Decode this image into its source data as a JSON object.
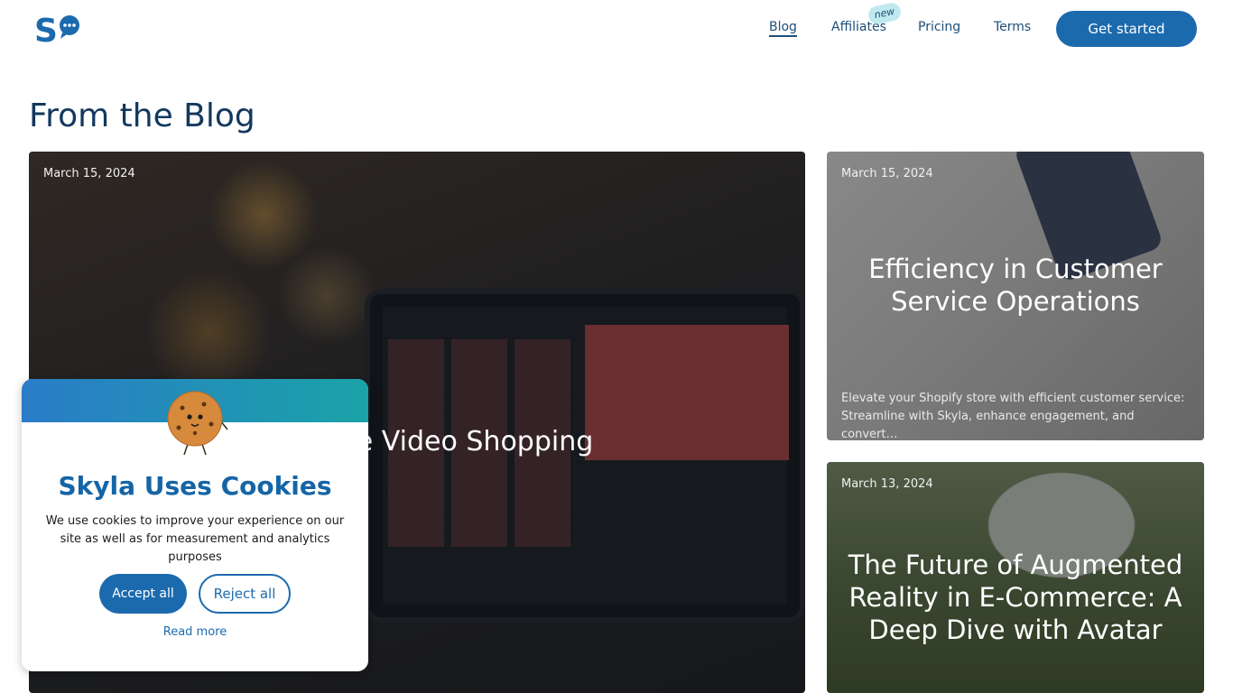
{
  "header": {
    "logo_text": "S",
    "nav": [
      {
        "label": "Blog",
        "active": true
      },
      {
        "label": "Affiliates",
        "active": false
      },
      {
        "label": "Pricing",
        "active": false
      },
      {
        "label": "Terms",
        "active": false
      }
    ],
    "new_badge": "new",
    "cta_label": "Get started"
  },
  "page_title": "From the Blog",
  "posts": [
    {
      "date": "March 15, 2024",
      "title": "Live Video Shopping",
      "excerpt": ""
    },
    {
      "date": "March 15, 2024",
      "title": "Efficiency in Customer Service Operations",
      "excerpt": "Elevate your Shopify store with efficient customer service: Streamline with Skyla, enhance engagement, and convert…"
    },
    {
      "date": "March 13, 2024",
      "title": "The Future of Augmented Reality in E-Commerce: A Deep Dive with Avatar",
      "excerpt": ""
    }
  ],
  "cookie": {
    "title": "Skyla Uses Cookies",
    "text": "We use cookies to improve your experience on our site as well as for measurement and analytics purposes",
    "accept_label": "Accept all",
    "reject_label": "Reject all",
    "read_more_label": "Read more"
  },
  "colors": {
    "brand": "#1c6aae",
    "heading": "#12385e",
    "badge_bg": "#bfe9ef"
  }
}
